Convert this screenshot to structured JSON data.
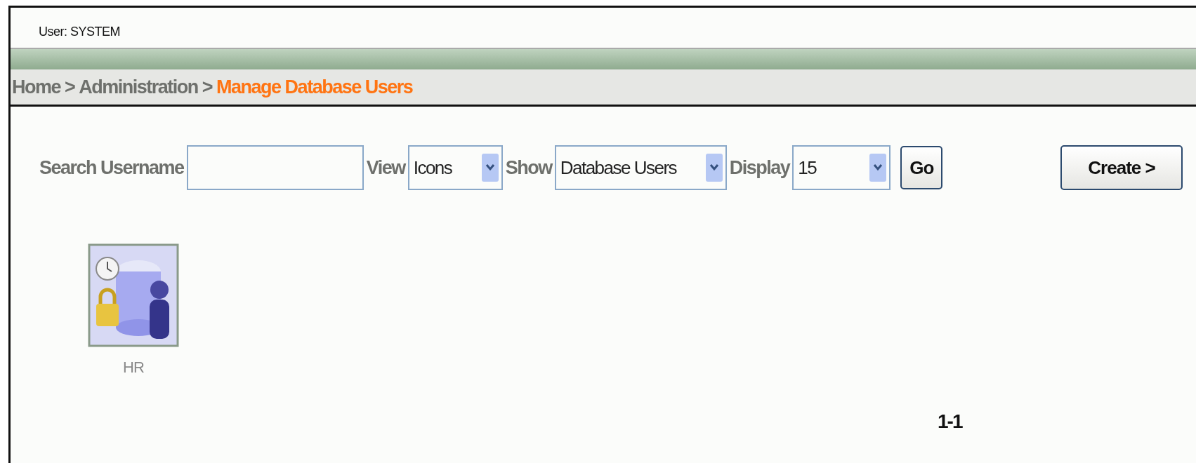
{
  "user_label": "User: SYSTEM",
  "breadcrumb": [
    {
      "label": "Home",
      "selected": false
    },
    {
      "label": "Administration",
      "prefix": ">",
      "selected": false
    },
    {
      "label": "Manage Database Users",
      "prefix": ">",
      "selected": true
    }
  ],
  "search": {
    "label": "Search Username"
  },
  "selects": [
    {
      "label": "View",
      "value": "Icons"
    },
    {
      "label": "Show",
      "value": "Database Users"
    },
    {
      "label": "Display",
      "value": "15"
    }
  ],
  "go_button": "Go",
  "create_button": "Create >",
  "users": [
    {
      "name": "HR"
    }
  ],
  "pagination": "1-1"
}
